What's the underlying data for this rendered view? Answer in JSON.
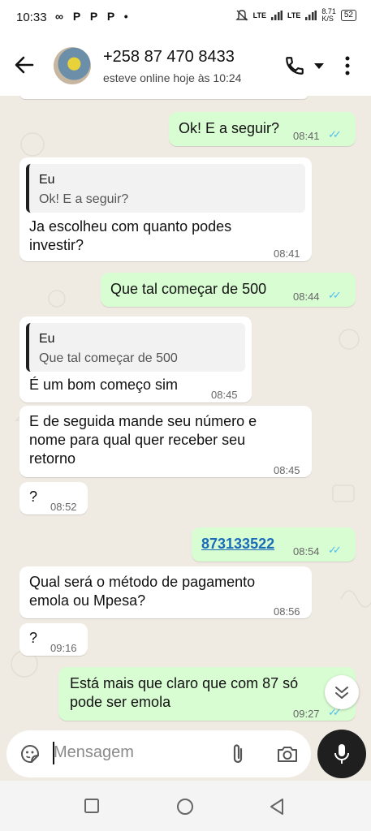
{
  "status_bar": {
    "time": "10:33",
    "left_icons": "∞ P P P •",
    "network": "LTE",
    "speed": "8.71",
    "speed_unit": "K/S",
    "battery": "52"
  },
  "header": {
    "contact_name": "+258 87 470 8433",
    "contact_status": "esteve online hoje às 10:24"
  },
  "messages": [
    {
      "dir": "out",
      "text": "Ok! E a seguir?",
      "time": "08:41",
      "ticks": "✓✓"
    },
    {
      "dir": "in",
      "quote_name": "Eu",
      "quote_text": "Ok! E a seguir?",
      "text": "Ja escolheu com quanto podes investir?",
      "time": "08:41"
    },
    {
      "dir": "out",
      "text": "Que tal começar de 500",
      "time": "08:44",
      "ticks": "✓✓"
    },
    {
      "dir": "in",
      "quote_name": "Eu",
      "quote_text": "Que tal começar de 500",
      "text": "É um bom começo sim",
      "time": "08:45"
    },
    {
      "dir": "in",
      "text": "E de seguida mande seu número e nome para qual quer receber seu retorno",
      "time": "08:45"
    },
    {
      "dir": "in",
      "text": "?",
      "time": "08:52"
    },
    {
      "dir": "out",
      "text": "873133522",
      "time": "08:54",
      "ticks": "✓✓"
    },
    {
      "dir": "in",
      "text": "Qual será o método de pagamento emola ou Mpesa?",
      "time": "08:56"
    },
    {
      "dir": "in",
      "text": "?",
      "time": "09:16"
    },
    {
      "dir": "out",
      "text": "Está mais que claro que com 87 só pode ser emola",
      "time": "09:27",
      "ticks": "✓✓"
    }
  ],
  "composer": {
    "placeholder": "Mensagem"
  },
  "colors": {
    "outgoing_bubble": "#d9fdd3",
    "incoming_bubble": "#ffffff",
    "chat_background": "#efeae2",
    "read_ticks": "#53bdeb",
    "link": "#1a6bb8"
  },
  "icons": [
    "back-arrow-icon",
    "phone-icon",
    "dropdown-icon",
    "more-icon",
    "sticker-icon",
    "attach-icon",
    "camera-icon",
    "mic-icon",
    "scroll-down-icon",
    "nav-recents-icon",
    "nav-home-icon",
    "nav-back-icon"
  ]
}
